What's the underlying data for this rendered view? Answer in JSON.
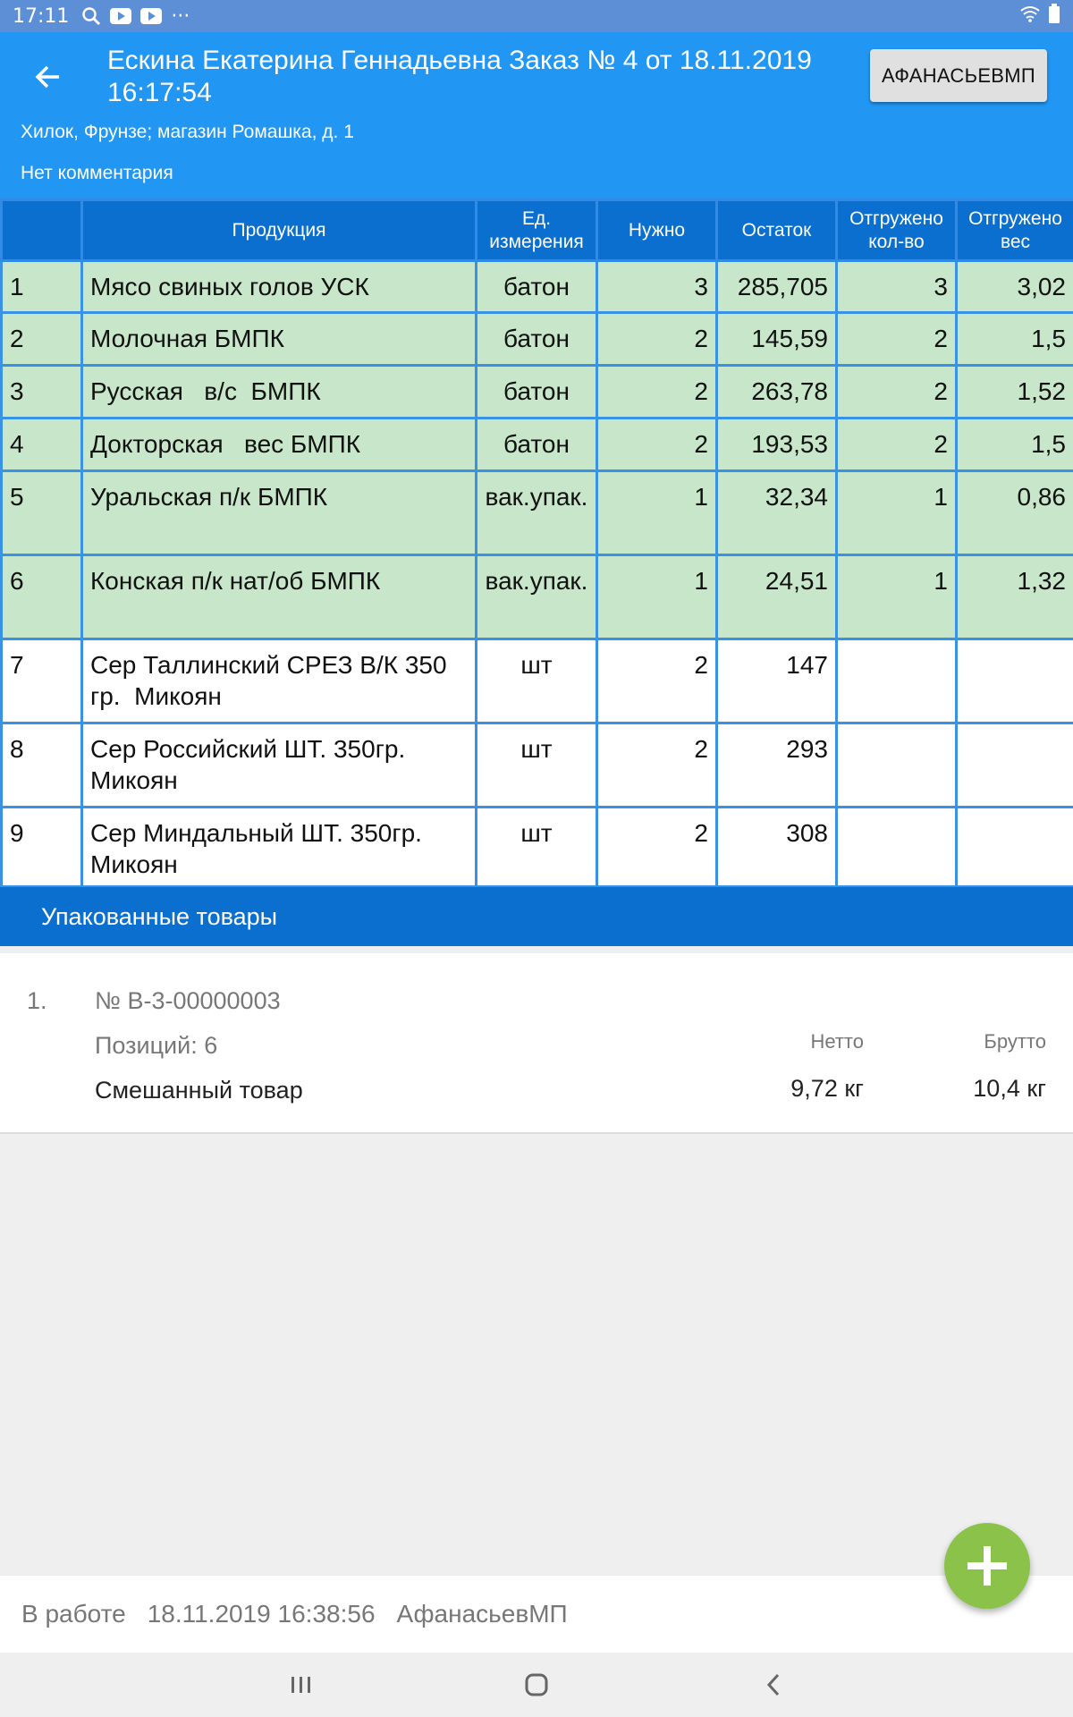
{
  "status_bar": {
    "time": "17:11",
    "icons": [
      "search-icon",
      "youtube-icon",
      "youtube-icon",
      "more-icon"
    ],
    "more_glyph": "···",
    "right_icons": [
      "wifi-icon",
      "battery-icon"
    ]
  },
  "header": {
    "title": "Ескина Екатерина Геннадьевна Заказ № 4 от 18.11.2019 16:17:54",
    "user_button": "АФАНАСЬЕВМП",
    "address": "Хилок, Фрунзе; магазин Ромашка, д. 1",
    "comment": "Нет комментария"
  },
  "table": {
    "columns": [
      "",
      "Продукция",
      "Ед. измерения",
      "Нужно",
      "Остаток",
      "Отгружено кол-во",
      "Отгружено вес"
    ],
    "rows": [
      {
        "n": "1",
        "product": "Мясо свиных голов УСК",
        "unit": "батон",
        "need": "3",
        "stock": "285,705",
        "shipped_qty": "3",
        "shipped_weight": "3,02",
        "shipped": true
      },
      {
        "n": "2",
        "product": "Молочная БМПК",
        "unit": "батон",
        "need": "2",
        "stock": "145,59",
        "shipped_qty": "2",
        "shipped_weight": "1,5",
        "shipped": true
      },
      {
        "n": "3",
        "product": "Русская   в/с  БМПК",
        "unit": "батон",
        "need": "2",
        "stock": "263,78",
        "shipped_qty": "2",
        "shipped_weight": "1,52",
        "shipped": true
      },
      {
        "n": "4",
        "product": "Докторская   вес БМПК",
        "unit": "батон",
        "need": "2",
        "stock": "193,53",
        "shipped_qty": "2",
        "shipped_weight": "1,5",
        "shipped": true
      },
      {
        "n": "5",
        "product": "Уральская п/к БМПК",
        "unit": "вак.упак.",
        "need": "1",
        "stock": "32,34",
        "shipped_qty": "1",
        "shipped_weight": "0,86",
        "shipped": true
      },
      {
        "n": "6",
        "product": "Конская п/к нат/об БМПК",
        "unit": "вак.упак.",
        "need": "1",
        "stock": "24,51",
        "shipped_qty": "1",
        "shipped_weight": "1,32",
        "shipped": true
      },
      {
        "n": "7",
        "product": "Сер Таллинский СРЕЗ В/К 350 гр.  Микоян",
        "unit": "шт",
        "need": "2",
        "stock": "147",
        "shipped_qty": "",
        "shipped_weight": "",
        "shipped": false
      },
      {
        "n": "8",
        "product": "Сер Российский ШТ. 350гр. Микоян",
        "unit": "шт",
        "need": "2",
        "stock": "293",
        "shipped_qty": "",
        "shipped_weight": "",
        "shipped": false
      },
      {
        "n": "9",
        "product": "Сер Миндальный ШТ. 350гр. Микоян",
        "unit": "шт",
        "need": "2",
        "stock": "308",
        "shipped_qty": "",
        "shipped_weight": "",
        "shipped": false
      }
    ]
  },
  "packed": {
    "header": "Упакованные товары",
    "items": [
      {
        "index": "1.",
        "number": "№ В-3-00000003",
        "positions": "Позиций: 6",
        "type": "Смешанный товар",
        "netto_label": "Нетто",
        "brutto_label": "Брутто",
        "netto": "9,72 кг",
        "brutto": "10,4 кг"
      }
    ]
  },
  "footer": {
    "status": "В работе",
    "datetime": "18.11.2019 16:38:56",
    "user": "АфанасьевМП"
  },
  "fab": {
    "icon": "plus-icon"
  },
  "colors": {
    "appbar": "#2196f3",
    "table_header": "#0a6fcf",
    "shipped_row": "#c8e6c9",
    "fab": "#8bc34a"
  }
}
